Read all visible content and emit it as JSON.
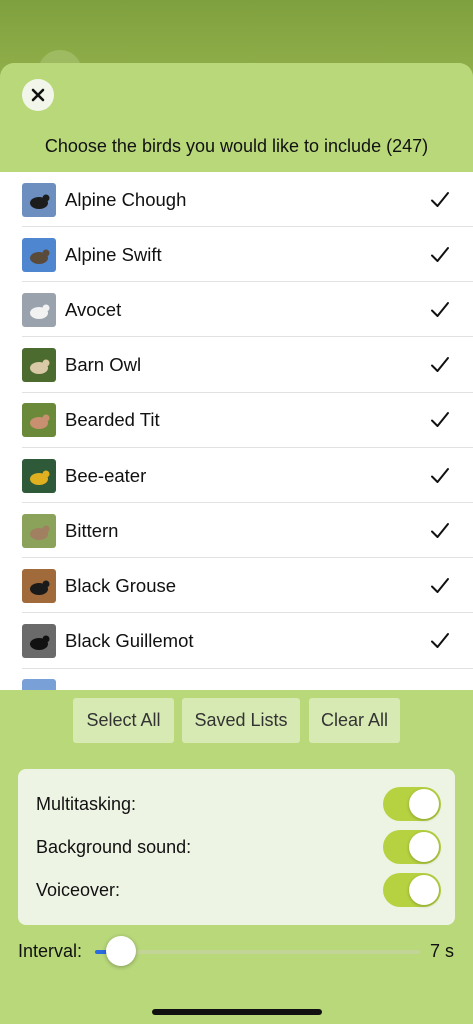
{
  "header": {
    "title": "Choose the birds you would like to include (247)"
  },
  "birds": [
    {
      "name": "Alpine Chough",
      "checked": true,
      "thumb_colors": [
        "#6d8fc0",
        "#1c1c1c"
      ]
    },
    {
      "name": "Alpine Swift",
      "checked": true,
      "thumb_colors": [
        "#4f86d0",
        "#5a4a3a"
      ]
    },
    {
      "name": "Avocet",
      "checked": true,
      "thumb_colors": [
        "#9aa3ad",
        "#f2f2f2"
      ]
    },
    {
      "name": "Barn Owl",
      "checked": true,
      "thumb_colors": [
        "#4c6b2f",
        "#d9c9a6"
      ]
    },
    {
      "name": "Bearded Tit",
      "checked": true,
      "thumb_colors": [
        "#6a8a3a",
        "#c89070"
      ]
    },
    {
      "name": "Bee-eater",
      "checked": true,
      "thumb_colors": [
        "#2f5a3a",
        "#e0b020"
      ]
    },
    {
      "name": "Bittern",
      "checked": true,
      "thumb_colors": [
        "#8aa25a",
        "#a08060"
      ]
    },
    {
      "name": "Black Grouse",
      "checked": true,
      "thumb_colors": [
        "#a06a3a",
        "#1a1a1a"
      ]
    },
    {
      "name": "Black Guillemot",
      "checked": true,
      "thumb_colors": [
        "#6a6a6a",
        "#111111"
      ]
    },
    {
      "name": "",
      "checked": false,
      "thumb_colors": [
        "#7aa0d8",
        "#3a3a3a"
      ]
    }
  ],
  "buttons": {
    "select_all": "Select All",
    "saved_lists": "Saved Lists",
    "clear_all": "Clear All"
  },
  "settings": [
    {
      "label": "Multitasking:",
      "on": true
    },
    {
      "label": "Background sound:",
      "on": true
    },
    {
      "label": "Voiceover:",
      "on": true
    }
  ],
  "interval": {
    "label": "Interval:",
    "value_text": "7 s",
    "fraction": 0.08
  },
  "colors": {
    "accent": "#b6d240",
    "background": "#b8d87a",
    "slider_fill": "#2a6be0"
  },
  "icons": {
    "close": "close-icon",
    "check": "checkmark-icon"
  }
}
